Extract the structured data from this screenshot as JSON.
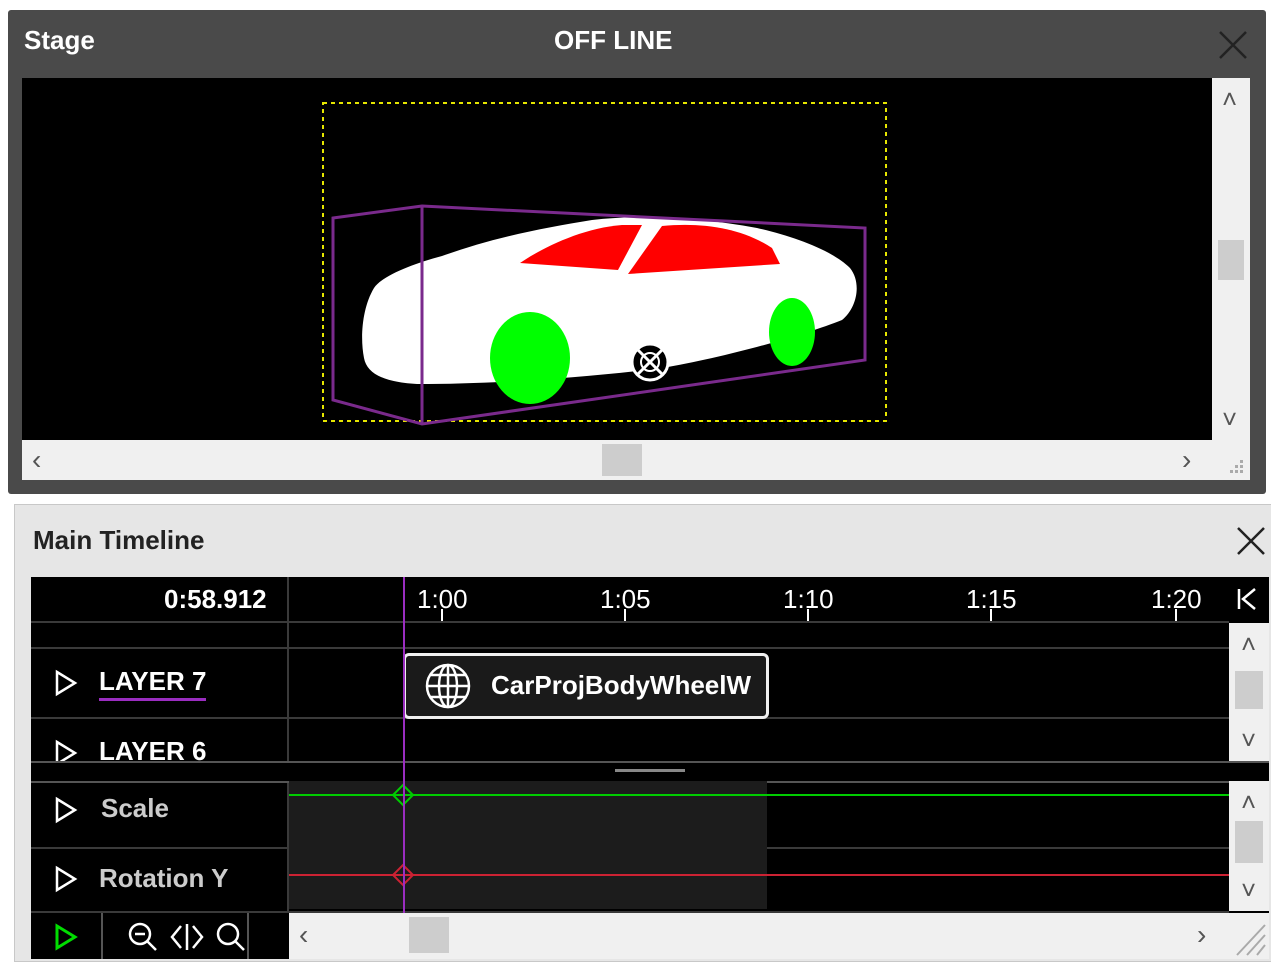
{
  "stage": {
    "title": "Stage",
    "status": "OFF LINE",
    "colors": {
      "car_body": "#ffffff",
      "windows": "#ff0000",
      "wheels": "#00ff00",
      "bbox": "#7a2a8c",
      "selection": "#e6e600"
    }
  },
  "timeline": {
    "title": "Main Timeline",
    "current_time": "0:58.912",
    "ticks": [
      "1:00",
      "1:05",
      "1:10",
      "1:15",
      "1:20"
    ],
    "layers": [
      {
        "label": "LAYER 7"
      },
      {
        "label": "LAYER 6"
      }
    ],
    "clip_label": "CarProjBodyWheelW",
    "tracks": [
      {
        "label": "Scale",
        "color": "#00cc00"
      },
      {
        "label": "Rotation Y",
        "color": "#cc2233"
      }
    ],
    "icons": {
      "go_start": "go-to-start-icon",
      "play": "play-icon",
      "zoom_out": "zoom-out-icon",
      "fit": "fit-width-icon",
      "zoom_in": "zoom-in-icon"
    }
  }
}
